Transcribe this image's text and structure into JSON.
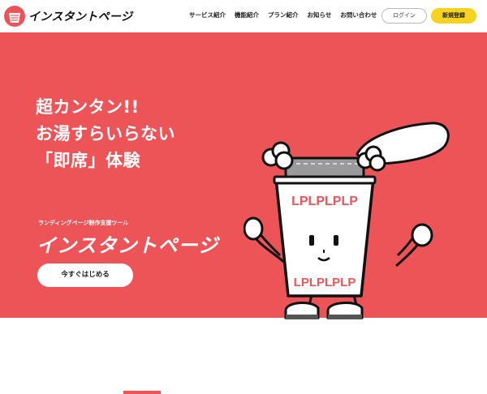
{
  "header": {
    "logo_text": "インスタントページ",
    "nav": [
      "サービス紹介",
      "機能紹介",
      "プラン紹介",
      "お知らせ",
      "お問い合わせ"
    ],
    "login_label": "ログイン",
    "signup_label": "新規登録"
  },
  "hero": {
    "headline": [
      "超カンタン!!",
      "お湯すらいらない",
      "「即席」体験"
    ],
    "subtitle": "ランディングページ制作支援ツール",
    "product_logo": "インスタントページ",
    "cta_label": "今すぐはじめる",
    "mascot": {
      "cup_text": "LPLPLPLP",
      "icon": "instant-cup-mascot"
    }
  },
  "colors": {
    "brand_red": "#ec5458",
    "accent_yellow": "#f7d31f",
    "white": "#ffffff"
  }
}
